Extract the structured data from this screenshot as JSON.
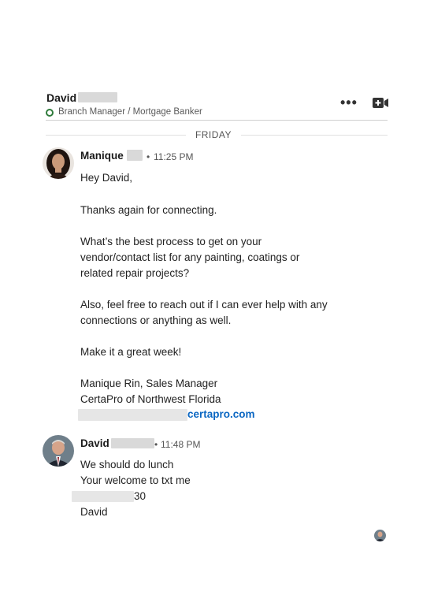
{
  "header": {
    "name": "David",
    "subtitle": "Branch Manager / Mortgage Banker",
    "more_icon": "more-horizontal-icon",
    "video_icon": "video-call-icon"
  },
  "divider": {
    "day": "FRIDAY"
  },
  "messages": [
    {
      "sender": "Manique",
      "dot": "•",
      "time": "11:25 PM",
      "lines": [
        "Hey David,",
        "Thanks again for connecting.",
        "What’s the best process to get on your",
        "vendor/contact list for any painting, coatings or",
        "related repair projects?",
        "Also, feel free to reach out if I can ever help with any",
        "connections or anything as well.",
        "Make it a great week!",
        "Manique Rin, Sales Manager",
        "CertaPro of Northwest Florida"
      ],
      "link_text": "certapro.com"
    },
    {
      "sender": "David",
      "dot": "•",
      "time": "11:48 PM",
      "lines": [
        "We should do lunch",
        "Your welcome to txt me",
        "30",
        "David"
      ]
    }
  ],
  "colors": {
    "link": "#0a66c2",
    "online": "#2f7b3b"
  }
}
